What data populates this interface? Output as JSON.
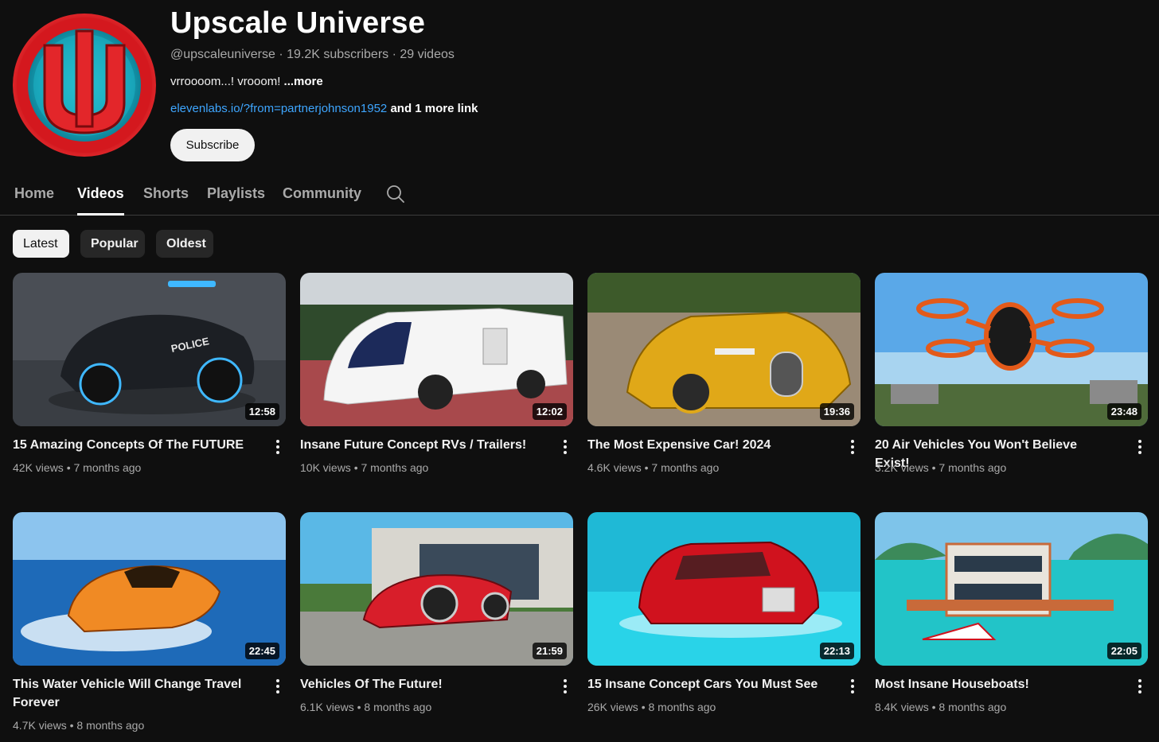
{
  "channel": {
    "name": "Upscale Universe",
    "handle": "@upscaleuniverse",
    "subscribers": "19.2K subscribers",
    "video_count": "29 videos",
    "separator": " · ",
    "description": "vrroooom...! vrooom! ",
    "more_label": "...more",
    "link": "elevenlabs.io/?from=partnerjohnson1952",
    "more_links": " and 1 more link",
    "subscribe_label": "Subscribe"
  },
  "tabs": [
    {
      "label": "Home",
      "active": false
    },
    {
      "label": "Videos",
      "active": true
    },
    {
      "label": "Shorts",
      "active": false
    },
    {
      "label": "Playlists",
      "active": false
    },
    {
      "label": "Community",
      "active": false
    }
  ],
  "chips": [
    {
      "label": "Latest",
      "active": true
    },
    {
      "label": "Popular",
      "active": false
    },
    {
      "label": "Oldest",
      "active": false
    }
  ],
  "videos": [
    {
      "title": "15 Amazing Concepts Of The FUTURE",
      "views": "42K views",
      "age": "7 months ago",
      "duration": "12:58",
      "thumb_colors": [
        "#5a5f66",
        "#3a3e44",
        "#1c1f24",
        "#3fb8ff"
      ]
    },
    {
      "title": "Insane Future Concept RVs / Trailers!",
      "views": "10K views",
      "age": "7 months ago",
      "duration": "12:02",
      "thumb_colors": [
        "#cfd4d8",
        "#2f4a2c",
        "#a8494c",
        "#f5f5f5"
      ]
    },
    {
      "title": "The Most Expensive Car! 2024",
      "views": "4.6K views",
      "age": "7 months ago",
      "duration": "19:36",
      "thumb_colors": [
        "#7aa3b3",
        "#3d5a2a",
        "#9a8a76",
        "#e0a818"
      ]
    },
    {
      "title": "20 Air Vehicles You Won't Believe Exist!",
      "views": "3.2K views",
      "age": "7 months ago",
      "duration": "23:48",
      "thumb_colors": [
        "#5aa8e8",
        "#a8d4f0",
        "#4f6b3a",
        "#e35a1a"
      ]
    },
    {
      "title": "This Water Vehicle Will Change Travel Forever",
      "views": "4.7K views",
      "age": "8 months ago",
      "duration": "22:45",
      "thumb_colors": [
        "#8cc4ee",
        "#e8f3fb",
        "#1e6ab8",
        "#f08a24"
      ]
    },
    {
      "title": "Vehicles Of The Future!",
      "views": "6.1K views",
      "age": "8 months ago",
      "duration": "21:59",
      "thumb_colors": [
        "#5ab8e6",
        "#4a7a3a",
        "#9a9a94",
        "#d81e2a"
      ]
    },
    {
      "title": "15 Insane Concept Cars You Must See",
      "views": "26K views",
      "age": "8 months ago",
      "duration": "22:13",
      "thumb_colors": [
        "#1fb9d6",
        "#29d3e8",
        "#0f9bb5",
        "#d0121e"
      ]
    },
    {
      "title": "Most Insane Houseboats!",
      "views": "8.4K views",
      "age": "8 months ago",
      "duration": "22:05",
      "thumb_colors": [
        "#7ec4ea",
        "#3c8a5a",
        "#22c4c8",
        "#c86a3a"
      ]
    }
  ]
}
